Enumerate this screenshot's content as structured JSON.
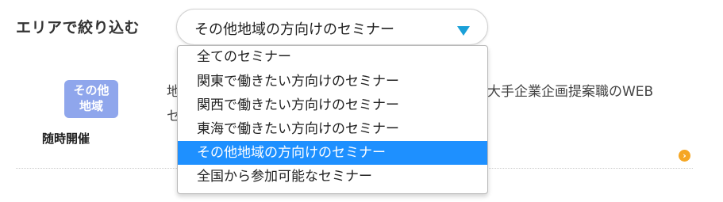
{
  "filter": {
    "label": "エリアで絞り込む",
    "selected_value": "その他地域の方向けのセミナー"
  },
  "dropdown": {
    "options": [
      "全てのセミナー",
      "関東で働きたい方向けのセミナー",
      "関西で働きたい方向けのセミナー",
      "東海で働きたい方向けのセミナー",
      "その他地域の方向けのセミナー",
      "全国から参加可能なセミナー"
    ],
    "selected_index": 4
  },
  "seminar": {
    "badge_line1": "その他",
    "badge_line2": "地域",
    "schedule": "随時開催",
    "desc_left_1": "地",
    "desc_left_2": "セ",
    "desc_right": "大手企業企画提案職のWEB",
    "more_arrow": "›"
  },
  "colors": {
    "accent": "#1aa0d8",
    "selected_bg": "#1e90ff",
    "badge_bg": "#8fa6ec",
    "more_arrow": "#f5a623"
  }
}
